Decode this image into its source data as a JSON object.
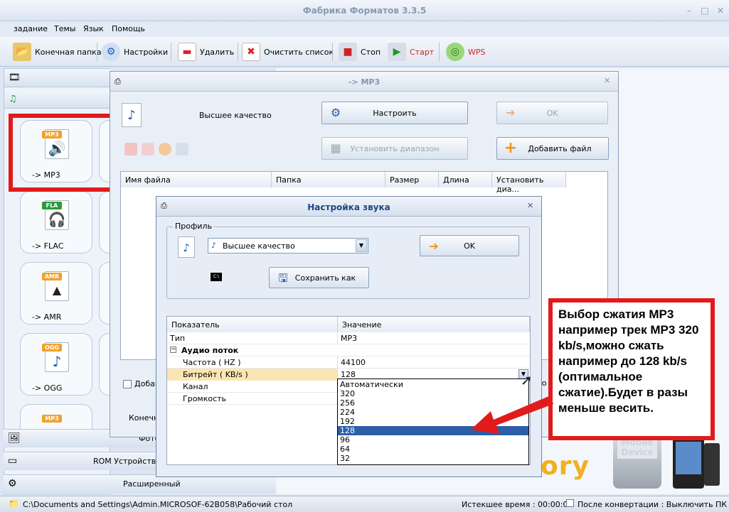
{
  "window": {
    "title": "Фабрика Форматов 3.3.5"
  },
  "menu": [
    "задание",
    "Темы",
    "Язык",
    "Помощь"
  ],
  "toolbar": {
    "dest_folder": "Конечная папка",
    "settings": "Настройки",
    "delete": "Удалить",
    "clear_list": "Очистить список",
    "stop": "Стоп",
    "start": "Старт",
    "wps": "WPS"
  },
  "left_panel": {
    "formats": [
      {
        "badge": "MP3",
        "label": "-> MP3"
      },
      {
        "badge": "FLA",
        "label": "-> FLAC"
      },
      {
        "badge": "AMR",
        "label": "-> AMR"
      },
      {
        "badge": "OGG",
        "label": "-> OGG"
      },
      {
        "badge": "MP3",
        "label": ""
      }
    ],
    "partial_right": "-",
    "bottom_cats": [
      "Фото",
      "ROM Устройство\\DVD\\CD\\ISO",
      "Расширенный"
    ]
  },
  "mp3_dialog": {
    "title": "-> MP3",
    "quality_label": "Высшее качество",
    "configure": "Настроить",
    "ok": "OK",
    "set_range": "Установить диапазон",
    "add_file": "Добавить файл",
    "columns": [
      "Имя файла",
      "Папка",
      "Размер",
      "Длина",
      "Установить диа..."
    ],
    "add_checkbox": "Добав",
    "dest_label": "Конечн",
    "right_partial": "бо"
  },
  "sound_dialog": {
    "title": "Настройка звука",
    "profile_group": "Профиль",
    "profile_value": "Высшее качество",
    "ok": "OK",
    "save_as": "Сохранить как",
    "table_headers": [
      "Показатель",
      "Значение"
    ],
    "rows": [
      {
        "key": "Тип",
        "value": "MP3"
      },
      {
        "key": "Аудио поток",
        "value": ""
      },
      {
        "key": "Частота ( HZ )",
        "value": "44100"
      },
      {
        "key": "Битрейт ( KB/s )",
        "value": "128"
      },
      {
        "key": "Канал",
        "value": ""
      },
      {
        "key": "Громкость",
        "value": ""
      }
    ],
    "bitrate_options": [
      "Автоматически",
      "320",
      "256",
      "224",
      "192",
      "128",
      "96",
      "64",
      "32"
    ],
    "selected_option": "128"
  },
  "annotation": "Выбор сжатия MP3 например трек MP3 320 kb/s,можно сжать например до 128 kb/s (оптимальное сжатие).Будет в разы меньше весить.",
  "logo_text": "ory",
  "device_text": "Mobile Device",
  "status": {
    "path": "C:\\Documents and Settings\\Admin.MICROSOF-62B058\\Рабочий стол",
    "elapsed": "Истекшее время : 00:00:00",
    "after_convert": "После конвертации : Выключить ПК"
  },
  "colors": {
    "accent_red": "#e11b1b",
    "selection_blue": "#2c5fa8",
    "title_blue": "#1e4781"
  }
}
